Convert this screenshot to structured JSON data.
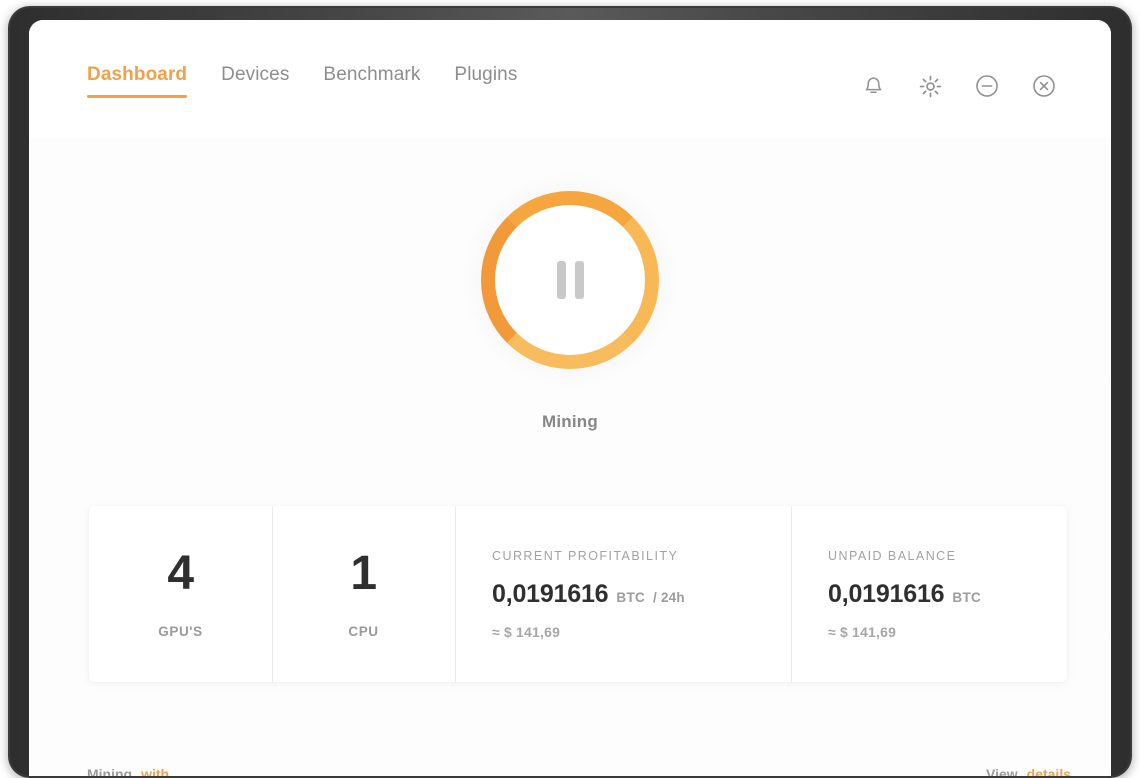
{
  "window": {
    "controls": [
      {
        "name": "notifications",
        "icon": "bell-icon"
      },
      {
        "name": "settings",
        "icon": "gear-icon"
      },
      {
        "name": "minimize",
        "icon": "circle-minus-icon"
      },
      {
        "name": "close",
        "icon": "circle-x-icon"
      }
    ]
  },
  "nav": {
    "tabs": [
      {
        "label": "Dashboard",
        "active": true
      },
      {
        "label": "Devices",
        "active": false
      },
      {
        "label": "Benchmark",
        "active": false
      },
      {
        "label": "Plugins",
        "active": false
      }
    ]
  },
  "mining": {
    "button_icon": "pause-icon",
    "status": "Mining",
    "ring_color": "#f5a63f"
  },
  "stats": {
    "gpus": {
      "value": "4",
      "label": "GPU'S"
    },
    "cpu": {
      "value": "1",
      "label": "CPU"
    },
    "profitability": {
      "title": "CURRENT PROFITABILITY",
      "amount": "0,0191616",
      "unit": "BTC",
      "period": "/ 24h",
      "fiat": "≈ $ 141,69"
    },
    "unpaid_balance": {
      "title": "UNPAID BALANCE",
      "amount": "0,0191616",
      "unit": "BTC",
      "fiat": "≈ $ 141,69"
    }
  },
  "footer": {
    "left_muted": "Mining",
    "left_accent": "with",
    "right_muted": "View",
    "right_accent": "details"
  },
  "colors": {
    "accent": "#f0a24a",
    "text_dark": "#2f2f2f",
    "text_muted": "#9a9a9a"
  }
}
